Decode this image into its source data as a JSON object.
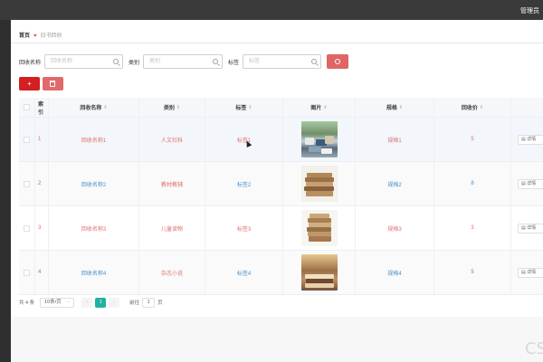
{
  "topbar": {
    "user": "管理员"
  },
  "breadcrumb": {
    "home": "首页",
    "current": "旧书回收"
  },
  "search": {
    "name_label": "回收名称",
    "name_placeholder": "回收名称",
    "category_label": "类别",
    "category_placeholder": "类别",
    "tag_label": "标签",
    "tag_placeholder": "标签"
  },
  "actions": {
    "add": "+"
  },
  "table": {
    "headers": {
      "index": "索引",
      "name": "回收名称",
      "category": "类别",
      "tag": "标签",
      "image": "图片",
      "spec": "规格",
      "price": "回收价"
    },
    "sort_glyph": "⇕",
    "rows": [
      {
        "index": "1",
        "name": "回收名称1",
        "category": "人文社科",
        "tag": "标签1",
        "spec": "规格1",
        "price": "5",
        "op": "详情"
      },
      {
        "index": "2",
        "name": "回收名称2",
        "category": "教材教辅",
        "tag": "标签2",
        "spec": "规格2",
        "price": "8",
        "op": "详情"
      },
      {
        "index": "3",
        "name": "回收名称3",
        "category": "儿童读物",
        "tag": "标签3",
        "spec": "规格3",
        "price": "3",
        "op": "详情"
      },
      {
        "index": "4",
        "name": "回收名称4",
        "category": "杂志小说",
        "tag": "标签4",
        "spec": "规格4",
        "price": "5",
        "op": "详情"
      }
    ]
  },
  "pager": {
    "total": "共 4 条",
    "size": "10条/页",
    "prev": "‹",
    "page": "1",
    "next": "›",
    "goto": "前往",
    "goto_value": "1",
    "page_unit": "页"
  },
  "watermark": "CS",
  "colors": {
    "accent_red": "#d21f1f",
    "search_red": "#e06565",
    "pager_active": "#20b2a0",
    "link_blue": "#4a90c8",
    "link_red": "#e07070"
  }
}
